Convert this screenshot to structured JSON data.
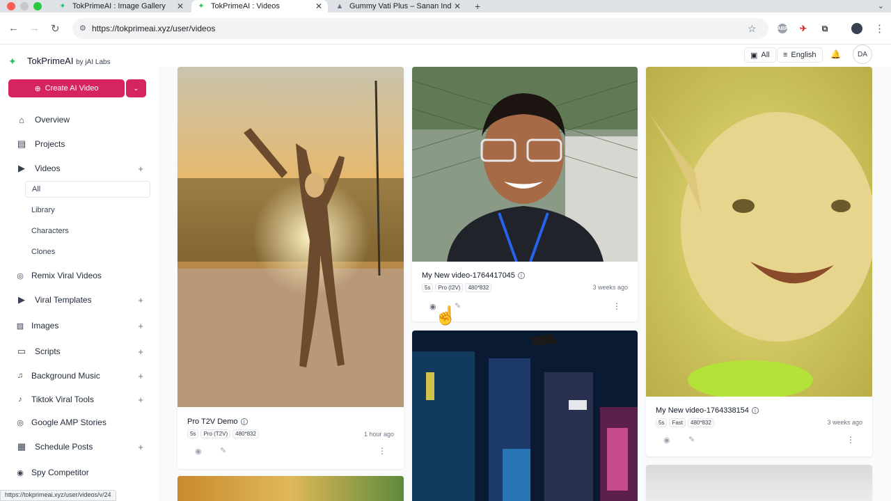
{
  "browser": {
    "tabs": [
      {
        "title": "TokPrimeAI : Image Gallery",
        "active": false
      },
      {
        "title": "TokPrimeAI : Videos",
        "active": true
      },
      {
        "title": "Gummy Vati Plus – Sanan Ind",
        "active": false
      }
    ],
    "url": "https://tokprimeai.xyz/user/videos",
    "ext_labels": [
      "ABP"
    ]
  },
  "header": {
    "brand": "TokPrimeAI",
    "brand_by": "by jAI Labs",
    "filter_label": "All",
    "language": "English",
    "avatar": "DA"
  },
  "sidebar": {
    "create_label": "Create AI Video",
    "items": [
      {
        "label": "Overview",
        "icon": "home-icon"
      },
      {
        "label": "Projects",
        "icon": "folder-icon"
      },
      {
        "label": "Videos",
        "icon": "play-icon"
      },
      {
        "label": "Remix Viral Videos",
        "icon": "fingerprint-icon"
      },
      {
        "label": "Viral Templates",
        "icon": "play-icon"
      },
      {
        "label": "Images",
        "icon": "image-icon"
      },
      {
        "label": "Scripts",
        "icon": "document-icon"
      },
      {
        "label": "Background Music",
        "icon": "music-icon"
      },
      {
        "label": "Tiktok Viral Tools",
        "icon": "tiktok-icon"
      },
      {
        "label": "Google AMP Stories",
        "icon": "fingerprint-icon"
      },
      {
        "label": "Schedule Posts",
        "icon": "calendar-icon"
      },
      {
        "label": "Spy Competitor",
        "icon": "eye-icon"
      }
    ],
    "video_sub": [
      "All",
      "Library",
      "Characters",
      "Clones"
    ]
  },
  "cards": [
    {
      "title": "Pro T2V Demo",
      "tags": [
        "5s",
        "Pro (T2V)",
        "480*832"
      ],
      "age": "1 hour ago"
    },
    {
      "title": "My New video-1764417045",
      "tags": [
        "5s",
        "Pro (I2V)",
        "480*832"
      ],
      "age": "3 weeks ago"
    },
    {
      "title": "My New video-1764338154",
      "tags": [
        "5s",
        "Fast",
        "480*832"
      ],
      "age": "3 weeks ago"
    }
  ],
  "status_url": "https://tokprimeai.xyz/user/videos/v/24",
  "colors": {
    "accent": "#d6245f",
    "logo": "#22c55e"
  }
}
